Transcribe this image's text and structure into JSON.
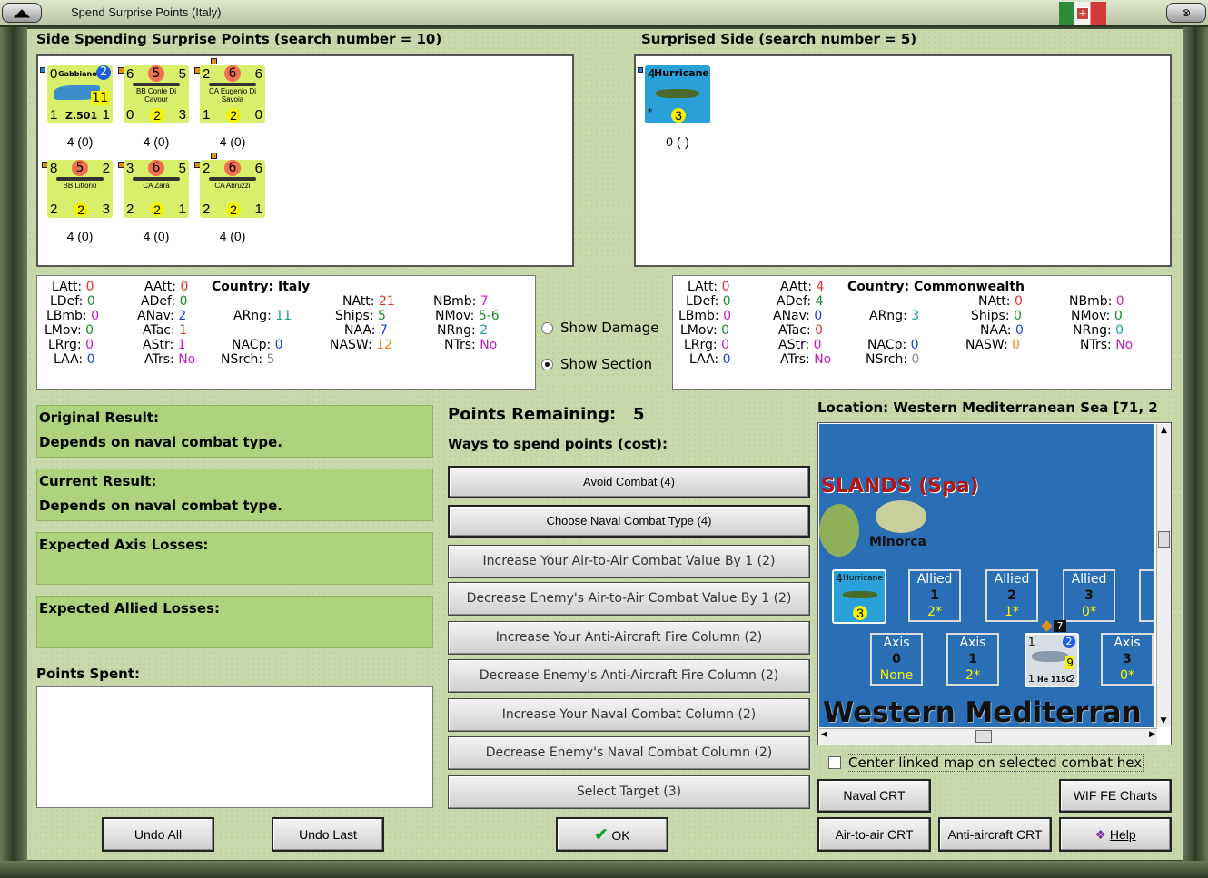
{
  "window": {
    "title": "Spend Surprise Points (Italy)",
    "sys_left": "◢◣",
    "sys_right": "⊗"
  },
  "left_header": "Side Spending Surprise Points (search number = 10)",
  "right_header": "Surprised Side (search number = 5)",
  "left_units": [
    {
      "tl": "0",
      "tr": "1",
      "badge": "2",
      "name": "Gabbiano",
      "code": "Z.501",
      "big": "11",
      "bl": "1",
      "bm": "",
      "br": "1",
      "cap": "4 (0)",
      "type": "air"
    },
    {
      "tl": "6",
      "red": "5",
      "tr": "5",
      "name": "BB Conte Di Cavour",
      "bl": "0",
      "bm": "2",
      "br": "3",
      "cap": "4 (0)",
      "type": "ship"
    },
    {
      "tl": "2",
      "red": "6",
      "tr": "6",
      "name": "CA Eugenio Di Savoia",
      "bl": "1",
      "bm": "2",
      "br": "0",
      "cap": "4 (0)",
      "type": "ship"
    },
    {
      "tl": "8",
      "red": "5",
      "tr": "2",
      "name": "BB Littorio",
      "bl": "2",
      "bm": "2",
      "br": "3",
      "cap": "4 (0)",
      "type": "ship"
    },
    {
      "tl": "3",
      "red": "6",
      "tr": "5",
      "name": "CA Zara",
      "bl": "2",
      "bm": "2",
      "br": "1",
      "cap": "4 (0)",
      "type": "ship"
    },
    {
      "tl": "2",
      "red": "6",
      "tr": "6",
      "name": "CA Abruzzi",
      "bl": "2",
      "bm": "2",
      "br": "1",
      "cap": "4 (0)",
      "type": "ship"
    }
  ],
  "right_units": [
    {
      "tl": "4",
      "name": "Hurricane",
      "star": "*",
      "bm": "3",
      "cap": "0 (-)"
    }
  ],
  "left_stats": {
    "country_label": "Country:",
    "country": "Italy",
    "LAtt": "0",
    "LDef": "0",
    "LBmb": "0",
    "LMov": "0",
    "LRrg": "0",
    "LAA": "0",
    "AAtt": "0",
    "ADef": "0",
    "ANav": "2",
    "ATac": "1",
    "AStr": "1",
    "ATrs": "No",
    "ARng": "11",
    "NACp": "0",
    "NSrch": "5",
    "NAtt": "21",
    "Ships": "5",
    "NAA": "7",
    "NASW": "12",
    "NBmb": "7",
    "NMov": "5-6",
    "NRng": "2",
    "NTrs": "No"
  },
  "right_stats": {
    "country_label": "Country:",
    "country": "Commonwealth",
    "LAtt": "0",
    "LDef": "0",
    "LBmb": "0",
    "LMov": "0",
    "LRrg": "0",
    "LAA": "0",
    "AAtt": "4",
    "ADef": "4",
    "ANav": "0",
    "ATac": "0",
    "AStr": "0",
    "ATrs": "No",
    "ARng": "3",
    "NACp": "0",
    "NSrch": "0",
    "NAtt": "0",
    "Ships": "0",
    "NAA": "0",
    "NASW": "0",
    "NBmb": "0",
    "NMov": "0",
    "NRng": "0",
    "NTrs": "No"
  },
  "options": {
    "show_damage": "Show Damage",
    "show_section": "Show Section"
  },
  "results": {
    "original_label": "Original Result:",
    "original_value": "Depends on naval combat type.",
    "current_label": "Current Result:",
    "current_value": "Depends on naval combat type.",
    "axis_losses_label": "Expected Axis Losses:",
    "allied_losses_label": "Expected Allied Losses:",
    "points_spent_label": "Points Spent:"
  },
  "points": {
    "remaining_label": "Points Remaining:",
    "remaining": "5",
    "ways_label": "Ways to spend points (cost):"
  },
  "spend_buttons": [
    "Avoid Combat (4)",
    "Choose Naval Combat Type (4)",
    "Increase Your Air-to-Air Combat Value By 1 (2)",
    "Decrease Enemy's Air-to-Air Combat Value By 1 (2)",
    "Increase Your Anti-Aircraft Fire Column (2)",
    "Decrease Enemy's Anti-Aircraft Fire Column (2)",
    "Increase Your Naval Combat Column (2)",
    "Decrease Enemy's Naval Combat Column (2)",
    "Select Target (3)"
  ],
  "bottom_buttons": {
    "undo_all": "Undo All",
    "undo_last": "Undo Last",
    "ok": "OK",
    "help": "Help"
  },
  "location": {
    "label": "Location: Western Mediterranean Sea [71, 2",
    "map_title": "SLANDS (Spa)",
    "island": "Minorca",
    "sea_label": "Western Mediterran"
  },
  "map_boxes": {
    "allied": [
      {
        "label": "Allied",
        "num": "1",
        "val": "2*"
      },
      {
        "label": "Allied",
        "num": "2",
        "val": "1*"
      },
      {
        "label": "Allied",
        "num": "3",
        "val": "0*"
      }
    ],
    "axis": [
      {
        "label": "Axis",
        "num": "0",
        "val": "None"
      },
      {
        "label": "Axis",
        "num": "1",
        "val": "2*"
      },
      {
        "label": "Axis",
        "num": "3",
        "val": "0*"
      }
    ],
    "map_hurricane": {
      "tl": "4",
      "name": "Hurricane",
      "val": "3"
    },
    "map_he": {
      "tl": "1",
      "badge": "2",
      "code": "He 115C",
      "bl": "1",
      "br": "2",
      "big": "9",
      "stack": "7"
    }
  },
  "center_linked": "Center linked map on selected combat hex",
  "chart_buttons": {
    "naval_crt": "Naval CRT",
    "wif_charts": "WIF FE Charts",
    "air_crt": "Air-to-air CRT",
    "aa_crt": "Anti-aircraft CRT"
  },
  "colors": {
    "panel_bg": "#c9d8ab",
    "result_bg": "#aed37c",
    "counter_italy": "#d7ef6a",
    "counter_cw": "#2aa0d8",
    "sea": "#2a6fb6"
  }
}
